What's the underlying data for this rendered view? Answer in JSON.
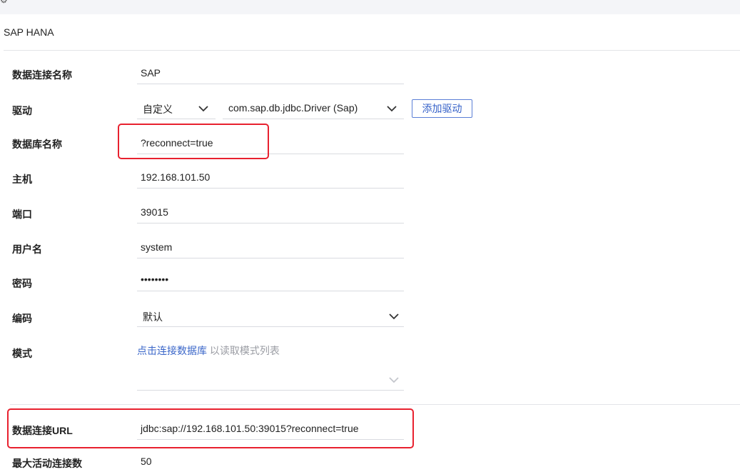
{
  "page": {
    "title": "SAP HANA"
  },
  "form": {
    "conn_name": {
      "label": "数据连接名称",
      "value": "SAP"
    },
    "driver": {
      "label": "驱动",
      "type_value": "自定义",
      "driver_value": "com.sap.db.jdbc.Driver (Sap)",
      "add_button": "添加驱动"
    },
    "db_name": {
      "label": "数据库名称",
      "value": "?reconnect=true"
    },
    "host": {
      "label": "主机",
      "value": "192.168.101.50"
    },
    "port": {
      "label": "端口",
      "value": "39015"
    },
    "username": {
      "label": "用户名",
      "value": "system"
    },
    "password": {
      "label": "密码",
      "masked": "••••••••"
    },
    "encoding": {
      "label": "编码",
      "value": "默认"
    },
    "schema": {
      "label": "模式",
      "link_text": "点击连接数据库",
      "hint_text": "以读取模式列表"
    },
    "url": {
      "label": "数据连接URL",
      "value": "jdbc:sap://192.168.101.50:39015?reconnect=true"
    },
    "max_active": {
      "label": "最大活动连接数",
      "value": "50"
    }
  },
  "colors": {
    "highlight": "#e8212f",
    "link": "#3a66c9",
    "accent_button": "#3460c8"
  },
  "icons": [
    "gear-icon",
    "chevron-down-icon"
  ]
}
